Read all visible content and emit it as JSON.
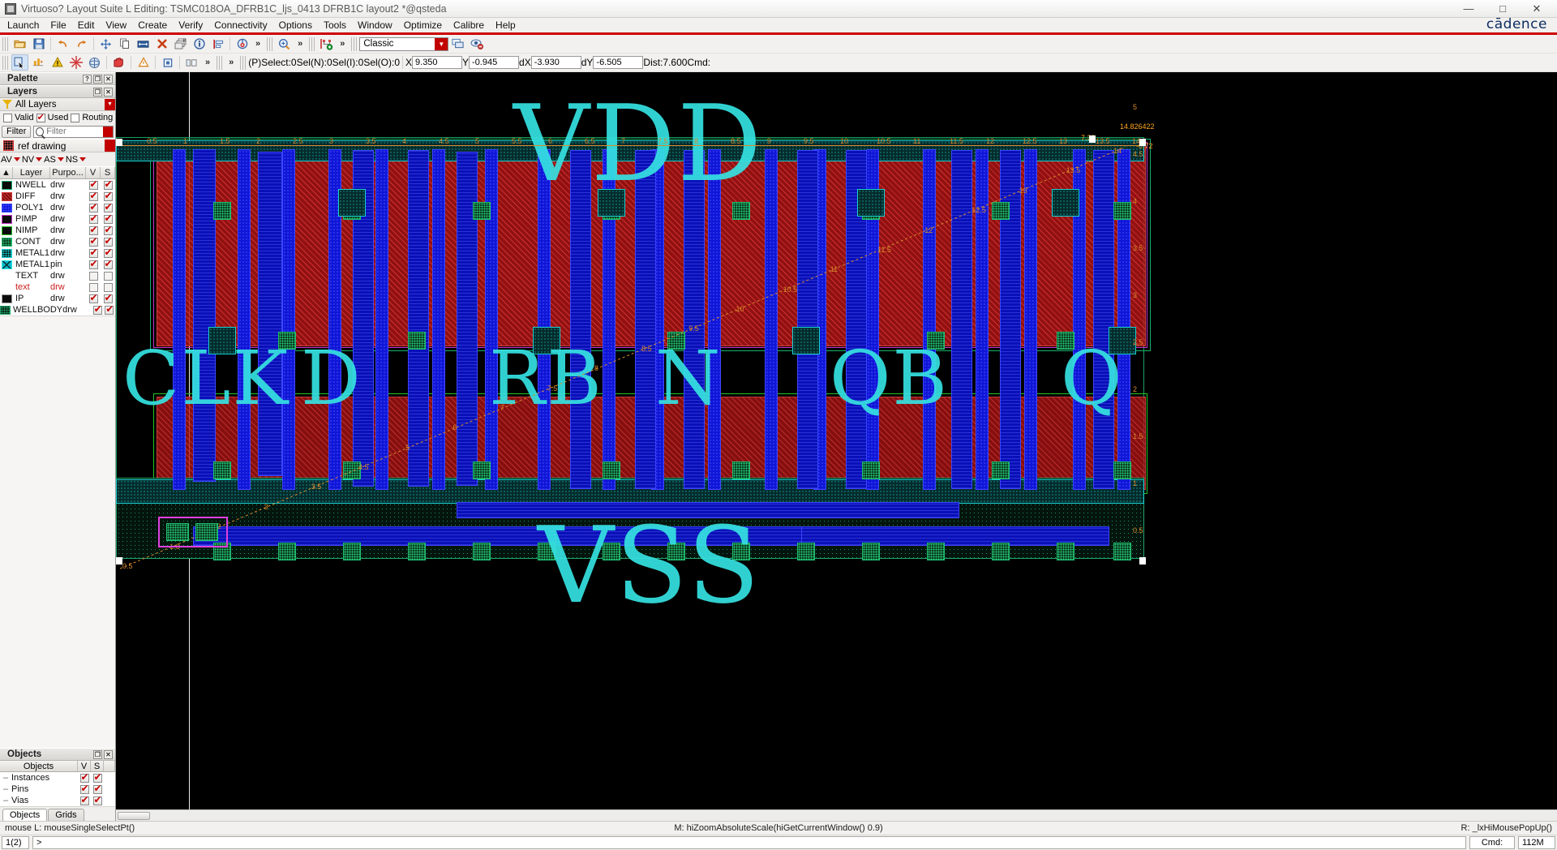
{
  "window": {
    "title": "Virtuoso? Layout Suite L Editing: TSMC018OA_DFRB1C_ljs_0413 DFRB1C layout2 *@qsteda",
    "minimize": "—",
    "maximize": "□",
    "close": "✕",
    "brand": "cādence"
  },
  "menubar": {
    "items": [
      "Launch",
      "File",
      "Edit",
      "View",
      "Create",
      "Verify",
      "Connectivity",
      "Options",
      "Tools",
      "Window",
      "Optimize",
      "Calibre",
      "Help"
    ]
  },
  "toolbar": {
    "row1_icons": [
      "open-icon",
      "save-icon",
      "undo-icon",
      "redo-icon",
      "move-icon",
      "copy-icon",
      "stretch-icon",
      "delete-icon",
      "hierarchy-icon",
      "properties-icon",
      "align-icon",
      "measure-icon"
    ],
    "chevron": "»",
    "zoom_icons": [
      "zoom-icon"
    ],
    "route_icons": [
      "add-route-icon"
    ],
    "palette_combo": "Classic",
    "palette_options": [
      "Classic"
    ],
    "row2_icons": [
      "instance-icon",
      "chart-icon",
      "warn-icon",
      "star-icon",
      "sphere-icon",
      "stop-icon",
      "caution-icon",
      "rect-icon",
      "split-icon",
      "compare-icon"
    ]
  },
  "coordbar": {
    "chevron": "»",
    "pselect_label": "(P)Select:0",
    "seln_label": "Sel(N):0",
    "seli_label": "Sel(I):0",
    "selo_label": "Sel(O):0",
    "x_label": "X",
    "x_value": "9.350",
    "y_label": "Y",
    "y_value": "-0.945",
    "dx_label": "dX",
    "dx_value": "-3.930",
    "dy_label": "dY",
    "dy_value": "-6.505",
    "dist_label": "Dist:7.600",
    "cmd_label": "Cmd:"
  },
  "palette": {
    "title": "Palette",
    "help_btn": "?",
    "float_btn": "❐",
    "close_btn": "✕"
  },
  "layers": {
    "title": "Layers",
    "float_btn": "❐",
    "close_btn": "✕",
    "all_layers": "All Layers",
    "valid_label": "Valid",
    "used_label": "Used",
    "routing_label": "Routing",
    "valid_checked": false,
    "used_checked": true,
    "routing_checked": false,
    "filter_button": "Filter",
    "filter_placeholder": "Filter",
    "filter_value": "",
    "ref_layer": "ref drawing",
    "mode_buttons": [
      "AV",
      "NV",
      "AS",
      "NS"
    ],
    "columns": [
      "Layer",
      "Purpo...",
      "V",
      "S"
    ],
    "rows": [
      {
        "name": "NWELL",
        "purpose": "drw",
        "v": true,
        "s": true,
        "color": "#0b0b0b",
        "border": "#18b06b",
        "pattern": "solid",
        "red": false
      },
      {
        "name": "DIFF",
        "purpose": "drw",
        "v": true,
        "s": true,
        "color": "#7c1010",
        "border": "#d03030",
        "pattern": "diag",
        "red": false
      },
      {
        "name": "POLY1",
        "purpose": "drw",
        "v": true,
        "s": true,
        "color": "#1016d8",
        "border": "#3d46ff",
        "pattern": "dots",
        "red": false
      },
      {
        "name": "PIMP",
        "purpose": "drw",
        "v": true,
        "s": true,
        "color": "#0b0b0b",
        "border": "#cc31cc",
        "pattern": "solid",
        "red": false
      },
      {
        "name": "NIMP",
        "purpose": "drw",
        "v": true,
        "s": true,
        "color": "#0b0b0b",
        "border": "#22c322",
        "pattern": "solid",
        "red": false
      },
      {
        "name": "CONT",
        "purpose": "drw",
        "v": true,
        "s": true,
        "color": "#0d3d22",
        "border": "#20c070",
        "pattern": "dots",
        "red": false
      },
      {
        "name": "METAL1",
        "purpose": "drw",
        "v": true,
        "s": true,
        "color": "#062b2b",
        "border": "#19d4d4",
        "pattern": "dots",
        "red": false
      },
      {
        "name": "METAL1",
        "purpose": "pin",
        "v": true,
        "s": true,
        "color": "#0bb8c8",
        "border": "#2de6e6",
        "pattern": "cross",
        "red": false
      },
      {
        "name": "TEXT",
        "purpose": "drw",
        "v": false,
        "s": false,
        "color": "#ffffff",
        "border": "#ffffff",
        "pattern": "none",
        "red": false
      },
      {
        "name": "text",
        "purpose": "drw",
        "v": false,
        "s": false,
        "color": "#ffffff",
        "border": "#ffffff",
        "pattern": "none",
        "red": true
      },
      {
        "name": "IP",
        "purpose": "drw",
        "v": true,
        "s": true,
        "color": "#0b0b0b",
        "border": "#9a9a9a",
        "pattern": "solid",
        "red": false
      },
      {
        "name": "WELLBODY",
        "purpose": "drw",
        "v": true,
        "s": true,
        "color": "#0b2a1a",
        "border": "#1fa56a",
        "pattern": "dots",
        "red": false
      }
    ]
  },
  "objects": {
    "title": "Objects",
    "float_btn": "❐",
    "close_btn": "✕",
    "columns": [
      "Objects",
      "V",
      "S"
    ],
    "rows": [
      {
        "name": "Instances",
        "v": true,
        "s": true
      },
      {
        "name": "Pins",
        "v": true,
        "s": true
      },
      {
        "name": "Vias",
        "v": true,
        "s": true
      }
    ],
    "tabs": [
      "Objects",
      "Grids"
    ],
    "active_tab": "Objects"
  },
  "canvas": {
    "cell_labels": [
      "VDD",
      "CLK",
      "D",
      "RB",
      "N",
      "QB",
      "Q",
      "VSS"
    ],
    "ruler_numbers": [
      "0.5",
      "1",
      "1.5",
      "2",
      "2.5",
      "3",
      "3.5",
      "4",
      "4.5",
      "5",
      "5.5",
      "6",
      "6.5",
      "7",
      "7.5",
      "8",
      "8.5",
      "9",
      "9.5",
      "10",
      "10.5",
      "11",
      "11.5",
      "12",
      "12.5",
      "13",
      "13.5",
      "14"
    ],
    "diag_numbers": [
      "0.5",
      "1.8",
      "2",
      "3",
      "3.5",
      "4.5",
      "5",
      "6",
      "7",
      "7.5",
      "8",
      "8.5",
      "9.5",
      "10",
      "10.5",
      "11",
      "11.5",
      "12",
      "12.5",
      "13",
      "13.5",
      "14"
    ],
    "y_ruler_numbers": [
      "0.5",
      "1",
      "1.5",
      "2",
      "2.5",
      "3",
      "3.5",
      "4",
      "4.5",
      "5"
    ],
    "coord_readout": "14.826422",
    "coord_readout2": "-0.72",
    "coord_readout3": "7.33"
  },
  "statusbar": {
    "left": "mouse L: mouseSingleSelectPt()",
    "center": "M: hiZoomAbsoluteScale(hiGetCurrentWindow() 0.9)",
    "right": "R: _lxHiMousePopUp()"
  },
  "cmdbar": {
    "session": "1(2)",
    "prompt": ">",
    "input": "",
    "cmd_label": "Cmd:",
    "mem": "112M"
  }
}
